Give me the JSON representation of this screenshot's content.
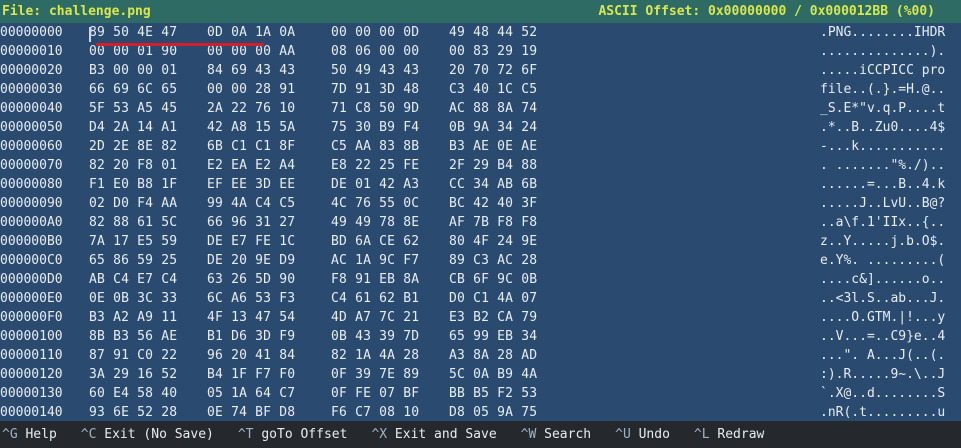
{
  "titlebar": {
    "file_label": "File: challenge.png",
    "offset_label": "ASCII Offset: 0x00000000 / 0x000012BB (%00)"
  },
  "colors": {
    "titlebar_bg": "#2f6b65",
    "title_text": "#d7e84f",
    "bg": "#2b4a6f",
    "status_bg": "#25282c",
    "marker": "#d21f2a"
  },
  "rows": [
    {
      "offset": "00000000",
      "g1": "89 50 4E 47",
      "g2": "0D 0A 1A 0A",
      "g3": "00 00 00 0D",
      "g4": "49 48 44 52",
      "ascii": ".PNG........IHDR"
    },
    {
      "offset": "00000010",
      "g1": "00 00 01 90",
      "g2": "00 00 00 AA",
      "g3": "08 06 00 00",
      "g4": "00 83 29 19",
      "ascii": "..............)."
    },
    {
      "offset": "00000020",
      "g1": "B3 00 00 01",
      "g2": "84 69 43 43",
      "g3": "50 49 43 43",
      "g4": "20 70 72 6F",
      "ascii": ".....iCCPICC pro"
    },
    {
      "offset": "00000030",
      "g1": "66 69 6C 65",
      "g2": "00 00 28 91",
      "g3": "7D 91 3D 48",
      "g4": "C3 40 1C C5",
      "ascii": "file..(.}.=H.@.."
    },
    {
      "offset": "00000040",
      "g1": "5F 53 A5 45",
      "g2": "2A 22 76 10",
      "g3": "71 C8 50 9D",
      "g4": "AC 88 8A 74",
      "ascii": "_S.E*\"v.q.P....t"
    },
    {
      "offset": "00000050",
      "g1": "D4 2A 14 A1",
      "g2": "42 A8 15 5A",
      "g3": "75 30 B9 F4",
      "g4": "0B 9A 34 24",
      "ascii": ".*..B..Zu0....4$"
    },
    {
      "offset": "00000060",
      "g1": "2D 2E 8E 82",
      "g2": "6B C1 C1 8F",
      "g3": "C5 AA 83 8B",
      "g4": "B3 AE 0E AE",
      "ascii": "-...k..........."
    },
    {
      "offset": "00000070",
      "g1": "82 20 F8 01",
      "g2": "E2 EA E2 A4",
      "g3": "E8 22 25 FE",
      "g4": "2F 29 B4 88",
      "ascii": ". .......\"%./).."
    },
    {
      "offset": "00000080",
      "g1": "F1 E0 B8 1F",
      "g2": "EF EE 3D EE",
      "g3": "DE 01 42 A3",
      "g4": "CC 34 AB 6B",
      "ascii": "......=...B..4.k"
    },
    {
      "offset": "00000090",
      "g1": "02 D0 F4 AA",
      "g2": "99 4A C4 C5",
      "g3": "4C 76 55 0C",
      "g4": "BC 42 40 3F",
      "ascii": ".....J..LvU..B@?"
    },
    {
      "offset": "000000A0",
      "g1": "82 88 61 5C",
      "g2": "66 96 31 27",
      "g3": "49 49 78 8E",
      "g4": "AF 7B F8 F8",
      "ascii": "..a\\f.1'IIx..{.."
    },
    {
      "offset": "000000B0",
      "g1": "7A 17 E5 59",
      "g2": "DE E7 FE 1C",
      "g3": "BD 6A CE 62",
      "g4": "80 4F 24 9E",
      "ascii": "z..Y.....j.b.O$."
    },
    {
      "offset": "000000C0",
      "g1": "65 86 59 25",
      "g2": "DE 20 9E D9",
      "g3": "AC 1A 9C F7",
      "g4": "89 C3 AC 28",
      "ascii": "e.Y%. .........("
    },
    {
      "offset": "000000D0",
      "g1": "AB C4 E7 C4",
      "g2": "63 26 5D 90",
      "g3": "F8 91 EB 8A",
      "g4": "CB 6F 9C 0B",
      "ascii": "....c&]......o.."
    },
    {
      "offset": "000000E0",
      "g1": "0E 0B 3C 33",
      "g2": "6C A6 53 F3",
      "g3": "C4 61 62 B1",
      "g4": "D0 C1 4A 07",
      "ascii": "..<3l.S..ab...J."
    },
    {
      "offset": "000000F0",
      "g1": "B3 A2 A9 11",
      "g2": "4F 13 47 54",
      "g3": "4D A7 7C 21",
      "g4": "E3 B2 CA 79",
      "ascii": "....O.GTM.|!...y"
    },
    {
      "offset": "00000100",
      "g1": "8B B3 56 AE",
      "g2": "B1 D6 3D F9",
      "g3": "0B 43 39 7D",
      "g4": "65 99 EB 34",
      "ascii": "..V...=..C9}e..4"
    },
    {
      "offset": "00000110",
      "g1": "87 91 C0 22",
      "g2": "96 20 41 84",
      "g3": "82 1A 4A 28",
      "g4": "A3 8A 28 AD",
      "ascii": "...\". A...J(..(."
    },
    {
      "offset": "00000120",
      "g1": "3A 29 16 52",
      "g2": "B4 1F F7 F0",
      "g3": "0F 39 7E 89",
      "g4": "5C 0A B9 4A",
      "ascii": ":).R.....9~.\\..J"
    },
    {
      "offset": "00000130",
      "g1": "60 E4 58 40",
      "g2": "05 1A 64 C7",
      "g3": "0F FE 07 BF",
      "g4": "BB B5 F2 53",
      "ascii": "`.X@..d........S"
    },
    {
      "offset": "00000140",
      "g1": "93 6E 52 28",
      "g2": "0E 74 BF D8",
      "g3": "F6 C7 08 10",
      "g4": "D8 05 9A 75",
      "ascii": ".nR(.t.........u"
    }
  ],
  "shortcuts": [
    {
      "key": "^G",
      "label": " Help"
    },
    {
      "key": "^C",
      "label": " Exit (No Save)"
    },
    {
      "key": "^T",
      "label": " goTo Offset"
    },
    {
      "key": "^X",
      "label": " Exit and Save"
    },
    {
      "key": "^W",
      "label": " Search"
    },
    {
      "key": "^U",
      "label": " Undo"
    },
    {
      "key": "^L",
      "label": " Redraw"
    }
  ]
}
